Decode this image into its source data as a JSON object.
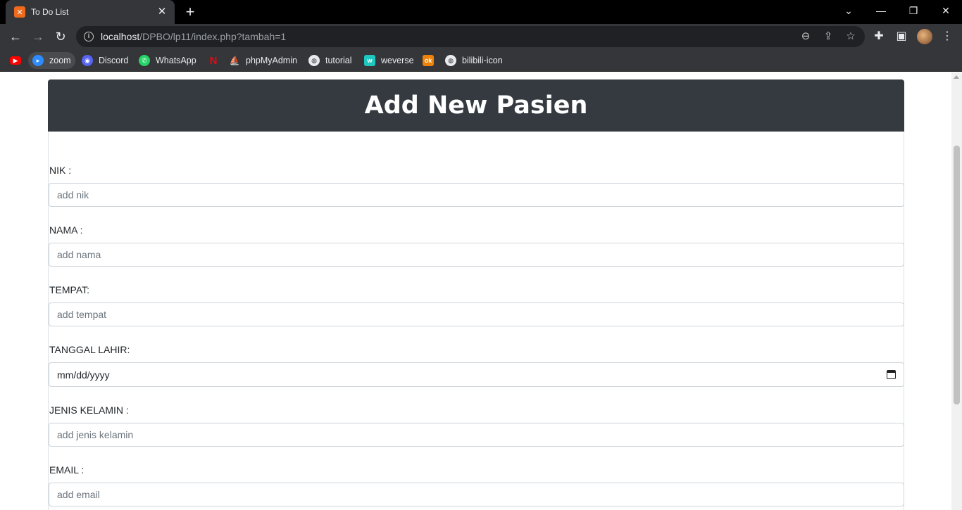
{
  "browser": {
    "tab_title": "To Do List",
    "tab_favicon": "xampp-icon",
    "url_host": "localhost",
    "url_path": "/DPBO/lp11/index.php?tambah=1",
    "bookmarks": [
      {
        "label": "",
        "icon": "youtube-icon",
        "color": "#ff0000"
      },
      {
        "label": "zoom",
        "icon": "zoom-icon",
        "color": "#2d8cff"
      },
      {
        "label": "Discord",
        "icon": "discord-icon",
        "color": "#5865f2"
      },
      {
        "label": "WhatsApp",
        "icon": "whatsapp-icon",
        "color": "#25d366"
      },
      {
        "label": "",
        "icon": "netflix-icon",
        "color": "#e50914"
      },
      {
        "label": "phpMyAdmin",
        "icon": "phpmyadmin-icon",
        "color": "#f29111"
      },
      {
        "label": "tutorial",
        "icon": "globe-icon",
        "color": "#e8eaed"
      },
      {
        "label": "weverse",
        "icon": "weverse-icon",
        "color": "#1ec6c0"
      },
      {
        "label": "",
        "icon": "odnoklassniki-icon",
        "color": "#ee8208"
      },
      {
        "label": "bilibili-icon",
        "icon": "globe-icon",
        "color": "#e8eaed"
      }
    ]
  },
  "page": {
    "heading": "Add New Pasien",
    "fields": [
      {
        "label": "NIK :",
        "placeholder": "add nik"
      },
      {
        "label": "NAMA :",
        "placeholder": "add nama"
      },
      {
        "label": "TEMPAT:",
        "placeholder": "add tempat"
      },
      {
        "label": "TANGGAL LAHIR:",
        "value": "mm/dd/yyyy"
      },
      {
        "label": "JENIS KELAMIN :",
        "placeholder": "add jenis kelamin"
      },
      {
        "label": "EMAIL :",
        "placeholder": "add email"
      }
    ]
  },
  "colors": {
    "header_bg": "#343a40",
    "chrome_bg": "#35363a",
    "input_border": "#ced4da"
  }
}
